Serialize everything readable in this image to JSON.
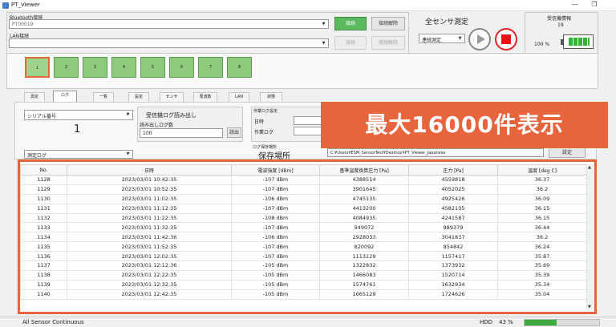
{
  "window": {
    "title": "PT_Viewer",
    "minimize": "—",
    "restore": "❐"
  },
  "bluetooth": {
    "label": "Bluetooth接続",
    "device": "PT00019",
    "connect": "接続",
    "disconnect": "接続解除"
  },
  "lan": {
    "label": "LAN接続",
    "device": "",
    "connect": "接続",
    "disconnect": "接続解除"
  },
  "measure": {
    "title": "全センサ測定",
    "mode": "連続測定"
  },
  "receiver": {
    "title": "受信機情報",
    "id": "19",
    "battery_text": "100 %",
    "battery_level": 1.0
  },
  "sensors": [
    "1",
    "2",
    "3",
    "4",
    "5",
    "6",
    "7",
    "8"
  ],
  "tabs": [
    "測定",
    "ログ",
    "一覧",
    "設定",
    "センサ",
    "周波数",
    "LAN",
    "状態"
  ],
  "left_panel": {
    "serial_select": "シリアル番号",
    "serial_value": "1",
    "log_select": "測定ログ"
  },
  "log_read": {
    "title": "受信機ログ読み出し",
    "count_label": "読み出しログ数",
    "count_value": "100",
    "button": "読出"
  },
  "log_settings": {
    "title": "作業ログ設定",
    "datetime_label": "日時",
    "worklog_label": "作業ログ"
  },
  "save": {
    "small_label": "ログ保存場所",
    "label": "保存場所",
    "path": "C:¥Users¥ESM_SensorTest¥Desktop¥PT_Viewer_Japanese",
    "button": "設定"
  },
  "callout": "最大16000件表示",
  "table": {
    "headers": [
      "No.",
      "日時",
      "電波強度 [dBm]",
      "基準温度換算圧力 [Pa]",
      "圧力 [Pa]",
      "温度 [deg C]"
    ],
    "rows": [
      [
        "1128",
        "2023/03/01 10:42:35",
        "-107 dBm",
        "4388514",
        "4559818",
        "36.37"
      ],
      [
        "1129",
        "2023/03/01 10:52:35",
        "-107 dBm",
        "3901645",
        "4052025",
        "36.2"
      ],
      [
        "1130",
        "2023/03/01 11:02:35",
        "-106 dBm",
        "4745135",
        "4925426",
        "36.09"
      ],
      [
        "1131",
        "2023/03/01 11:12:35",
        "-107 dBm",
        "4413200",
        "4582135",
        "36.15"
      ],
      [
        "1132",
        "2023/03/01 11:22:35",
        "-108 dBm",
        "4084935",
        "4241587",
        "36.15"
      ],
      [
        "1133",
        "2023/03/01 11:32:35",
        "-107 dBm",
        "949072",
        "989379",
        "36.44"
      ],
      [
        "1134",
        "2023/03/01 11:42:36",
        "-106 dBm",
        "2928033",
        "3041837",
        "36.2"
      ],
      [
        "1135",
        "2023/03/01 11:52:35",
        "-107 dBm",
        "820092",
        "854842",
        "36.24"
      ],
      [
        "1136",
        "2023/03/01 12:02:35",
        "-107 dBm",
        "1113129",
        "1157417",
        "35.87"
      ],
      [
        "1137",
        "2023/03/01 12:12:36",
        "-105 dBm",
        "1322832",
        "1373932",
        "35.69"
      ],
      [
        "1138",
        "2023/03/01 12:22:35",
        "-105 dBm",
        "1466083",
        "1520714",
        "35.39"
      ],
      [
        "1139",
        "2023/03/01 12:32:35",
        "-105 dBm",
        "1574761",
        "1632934",
        "35.34"
      ],
      [
        "1140",
        "2023/03/01 12:42:35",
        "-105 dBm",
        "1665129",
        "1724626",
        "35.04"
      ]
    ]
  },
  "status": {
    "left": "All Sensor Continuous",
    "hdd_label": "HDD",
    "hdd_value": "43 %",
    "hdd_level": 0.43
  }
}
